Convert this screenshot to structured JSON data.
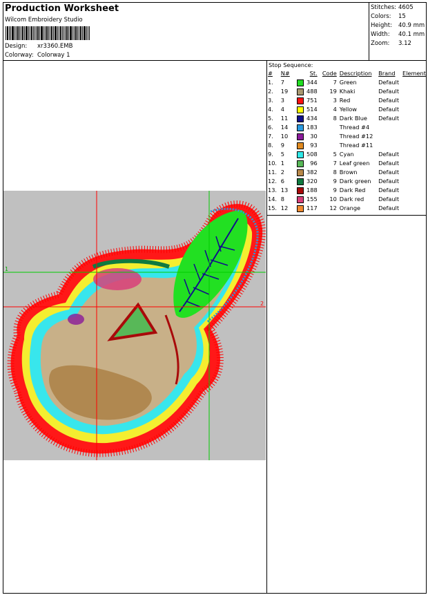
{
  "header": {
    "title": "Production Worksheet",
    "software": "Wilcom Embroidery Studio",
    "design_label": "Design:",
    "design_value": "xr3360.EMB",
    "colorway_label": "Colorway:",
    "colorway_value": "Colorway 1"
  },
  "stats": [
    {
      "label": "Stitches:",
      "value": "4605"
    },
    {
      "label": "Colors:",
      "value": "15"
    },
    {
      "label": "Height:",
      "value": "40.9 mm"
    },
    {
      "label": "Width:",
      "value": "40.1 mm"
    },
    {
      "label": "Zoom:",
      "value": "3.12"
    }
  ],
  "stop_sequence": {
    "title": "Stop Sequence:",
    "columns": [
      "#",
      "N#",
      "St.",
      "Code",
      "Description",
      "Brand",
      "Element"
    ],
    "rows": [
      {
        "idx": "1.",
        "n": "7",
        "color": "#22dd22",
        "st": "344",
        "code": "7",
        "desc": "Green",
        "brand": "Default"
      },
      {
        "idx": "2.",
        "n": "19",
        "color": "#a89870",
        "st": "488",
        "code": "19",
        "desc": "Khaki",
        "brand": "Default"
      },
      {
        "idx": "3.",
        "n": "3",
        "color": "#ff1010",
        "st": "751",
        "code": "3",
        "desc": "Red",
        "brand": "Default"
      },
      {
        "idx": "4.",
        "n": "4",
        "color": "#ffff00",
        "st": "514",
        "code": "4",
        "desc": "Yellow",
        "brand": "Default"
      },
      {
        "idx": "5.",
        "n": "11",
        "color": "#10108a",
        "st": "434",
        "code": "8",
        "desc": "Dark Blue",
        "brand": "Default"
      },
      {
        "idx": "6.",
        "n": "14",
        "color": "#2a9ae0",
        "st": "183",
        "code": "",
        "desc": "Thread #4",
        "brand": ""
      },
      {
        "idx": "7.",
        "n": "10",
        "color": "#8a1a9a",
        "st": "30",
        "code": "",
        "desc": "Thread #12",
        "brand": ""
      },
      {
        "idx": "8.",
        "n": "9",
        "color": "#e08a20",
        "st": "93",
        "code": "",
        "desc": "Thread #11",
        "brand": ""
      },
      {
        "idx": "9.",
        "n": "5",
        "color": "#30e8e8",
        "st": "508",
        "code": "5",
        "desc": "Cyan",
        "brand": "Default"
      },
      {
        "idx": "10.",
        "n": "1",
        "color": "#58b858",
        "st": "96",
        "code": "7",
        "desc": "Leaf green",
        "brand": "Default"
      },
      {
        "idx": "11.",
        "n": "2",
        "color": "#b8884a",
        "st": "382",
        "code": "8",
        "desc": "Brown",
        "brand": "Default"
      },
      {
        "idx": "12.",
        "n": "6",
        "color": "#107a40",
        "st": "320",
        "code": "9",
        "desc": "Dark green",
        "brand": "Default"
      },
      {
        "idx": "13.",
        "n": "13",
        "color": "#a80a0a",
        "st": "188",
        "code": "9",
        "desc": "Dark Red",
        "brand": "Default"
      },
      {
        "idx": "14.",
        "n": "8",
        "color": "#d8407a",
        "st": "155",
        "code": "10",
        "desc": "Dark red",
        "brand": "Default"
      },
      {
        "idx": "15.",
        "n": "12",
        "color": "#f08a30",
        "st": "117",
        "code": "12",
        "desc": "Orange",
        "brand": "Default"
      }
    ]
  },
  "design_preview": {
    "background_color": "#c0c0c0",
    "crosshair_color_red": "#ff0000",
    "crosshair_color_green": "#00cc00",
    "marker_1": "1",
    "marker_2": "2"
  }
}
